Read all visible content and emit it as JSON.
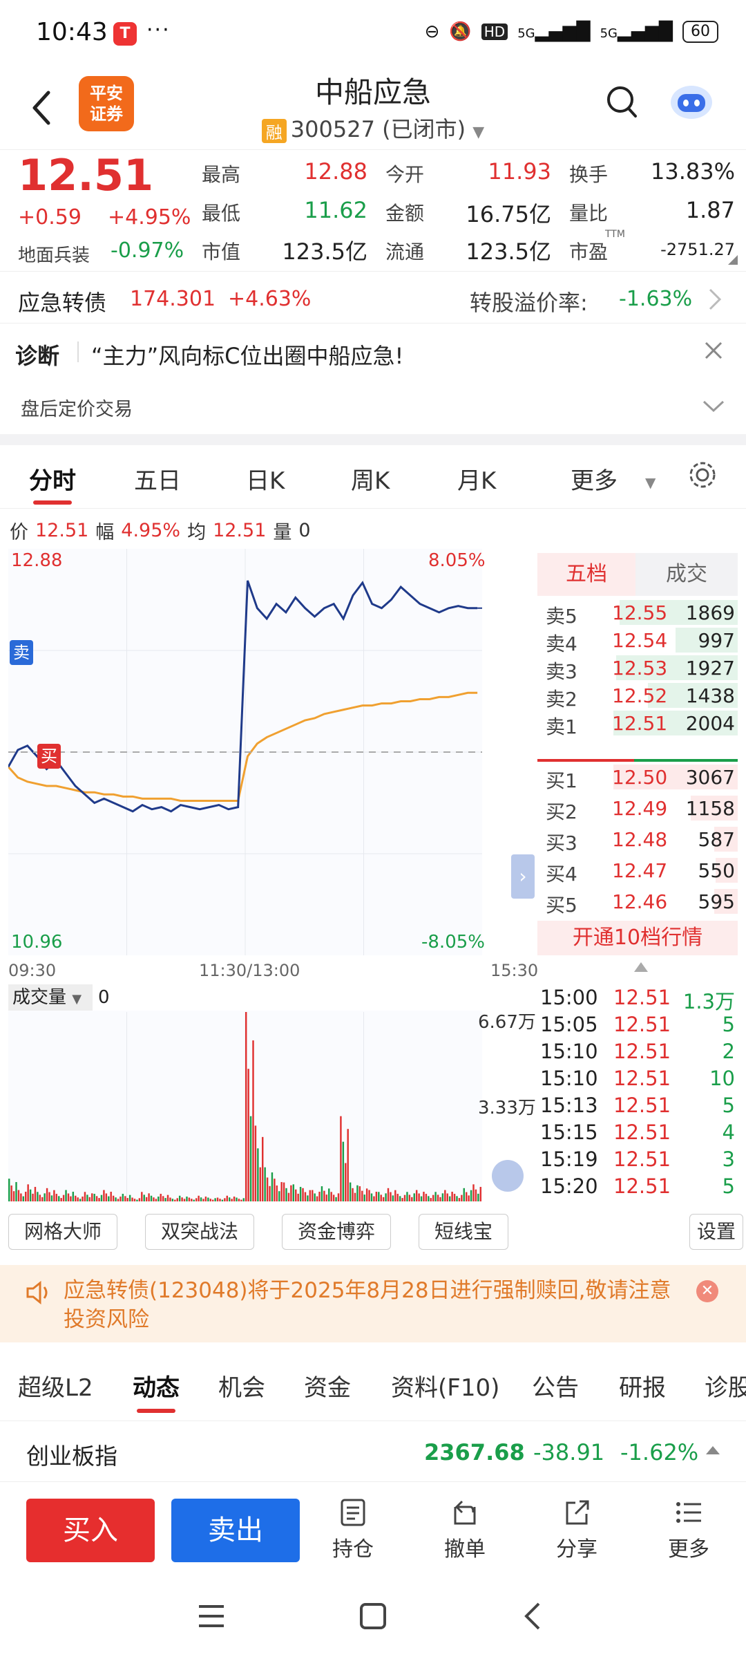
{
  "status_bar": {
    "time": "10:43",
    "dots": "···",
    "battery": "60",
    "network1": "5G",
    "network2": "5G",
    "hd": "HD"
  },
  "header": {
    "title": "中船应急",
    "rong": "融",
    "code_status": "300527 (已闭市)",
    "brand_logo": "平安\n证券"
  },
  "quote": {
    "price": "12.51",
    "change": "+0.59",
    "change_pct": "+4.95%",
    "sector_name": "地面兵装",
    "sector_chg": "-0.97%",
    "stats": [
      {
        "label": "最高",
        "value": "12.88",
        "color": "red"
      },
      {
        "label": "今开",
        "value": "11.93",
        "color": "red"
      },
      {
        "label": "换手",
        "value": "13.83%",
        "color": "black"
      },
      {
        "label": "最低",
        "value": "11.62",
        "color": "green"
      },
      {
        "label": "金额",
        "value": "16.75亿",
        "color": "black"
      },
      {
        "label": "量比",
        "value": "1.87",
        "color": "black"
      },
      {
        "label": "市值",
        "value": "123.5亿",
        "color": "black"
      },
      {
        "label": "流通",
        "value": "123.5亿",
        "color": "black"
      },
      {
        "label": "市盈",
        "value": "-2751.27",
        "color": "black"
      }
    ],
    "pe_sup": "TTM"
  },
  "bond": {
    "name": "应急转债",
    "price": "174.301",
    "chg": "+4.63%",
    "premium_label": "转股溢价率:",
    "premium": "-1.63%"
  },
  "diagnosis": {
    "label": "诊断",
    "text": "“主力”风向标C位出圈中船应急!"
  },
  "after_hours": {
    "label": "盘后定价交易"
  },
  "chart_tabs": [
    "分时",
    "五日",
    "日K",
    "周K",
    "月K",
    "更多"
  ],
  "info_line": {
    "price_label": "价",
    "price": "12.51",
    "amp_label": "幅",
    "amp": "4.95%",
    "avg_label": "均",
    "avg": "12.51",
    "vol_label": "量",
    "vol": "0"
  },
  "chart_data": {
    "type": "line",
    "y_top": "12.88",
    "y_bottom": "10.96",
    "pct_top": "8.05%",
    "pct_bottom": "-8.05%",
    "x_labels": [
      "09:30",
      "11:30/13:00",
      "15:30"
    ],
    "ylim": [
      10.96,
      12.88
    ],
    "prev_close": 11.92,
    "price_series": [
      11.85,
      11.93,
      11.95,
      11.9,
      11.84,
      11.88,
      11.82,
      11.76,
      11.72,
      11.68,
      11.7,
      11.68,
      11.66,
      11.64,
      11.67,
      11.65,
      11.66,
      11.64,
      11.67,
      11.66,
      11.65,
      11.66,
      11.67,
      11.65,
      11.66,
      12.73,
      12.6,
      12.55,
      12.62,
      12.58,
      12.65,
      12.6,
      12.56,
      12.6,
      12.62,
      12.55,
      12.66,
      12.72,
      12.62,
      12.6,
      12.64,
      12.7,
      12.66,
      12.62,
      12.6,
      12.58,
      12.6,
      12.61,
      12.6,
      12.6
    ],
    "avg_series": [
      11.85,
      11.8,
      11.78,
      11.77,
      11.76,
      11.76,
      11.75,
      11.74,
      11.73,
      11.73,
      11.72,
      11.72,
      11.71,
      11.71,
      11.7,
      11.7,
      11.7,
      11.7,
      11.69,
      11.69,
      11.69,
      11.69,
      11.69,
      11.69,
      11.69,
      11.9,
      11.96,
      11.99,
      12.01,
      12.03,
      12.05,
      12.07,
      12.08,
      12.1,
      12.11,
      12.12,
      12.13,
      12.14,
      12.14,
      12.15,
      12.15,
      12.16,
      12.16,
      12.17,
      12.17,
      12.18,
      12.18,
      12.19,
      12.2,
      12.2
    ],
    "markers": {
      "sell": "卖",
      "buy": "买"
    }
  },
  "order_book": {
    "tabs": [
      "五档",
      "成交"
    ],
    "asks": [
      {
        "label": "卖5",
        "price": "12.55",
        "vol": "1869",
        "fill": 0.95
      },
      {
        "label": "卖4",
        "price": "12.54",
        "vol": "997",
        "fill": 0.5
      },
      {
        "label": "卖3",
        "price": "12.53",
        "vol": "1927",
        "fill": 0.98
      },
      {
        "label": "卖2",
        "price": "12.52",
        "vol": "1438",
        "fill": 0.72
      },
      {
        "label": "卖1",
        "price": "12.51",
        "vol": "2004",
        "fill": 1.0
      }
    ],
    "bids": [
      {
        "label": "买1",
        "price": "12.50",
        "vol": "3067",
        "fill": 1.0
      },
      {
        "label": "买2",
        "price": "12.49",
        "vol": "1158",
        "fill": 0.38
      },
      {
        "label": "买3",
        "price": "12.48",
        "vol": "587",
        "fill": 0.19
      },
      {
        "label": "买4",
        "price": "12.47",
        "vol": "550",
        "fill": 0.18
      },
      {
        "label": "买5",
        "price": "12.46",
        "vol": "595",
        "fill": 0.19
      }
    ],
    "upgrade": "开通10档行情"
  },
  "volume_panel": {
    "label": "成交量",
    "value": "0",
    "max_label": "6.67万",
    "mid_label": "3.33万"
  },
  "volume_data": [
    12,
    6,
    9,
    5,
    7,
    4,
    6,
    3,
    5,
    4,
    6,
    3,
    4,
    2,
    5,
    3,
    4,
    2,
    3,
    2,
    3,
    2,
    2,
    3,
    2,
    100,
    40,
    18,
    12,
    10,
    9,
    7,
    6,
    8,
    5,
    45,
    10,
    8,
    6,
    5,
    7,
    4,
    5,
    6,
    4,
    5,
    6,
    4,
    7,
    9
  ],
  "ticks": [
    {
      "time": "15:00",
      "price": "12.51",
      "vol": "1.3万"
    },
    {
      "time": "15:05",
      "price": "12.51",
      "vol": "5"
    },
    {
      "time": "15:10",
      "price": "12.51",
      "vol": "2"
    },
    {
      "time": "15:10",
      "price": "12.51",
      "vol": "10"
    },
    {
      "time": "15:13",
      "price": "12.51",
      "vol": "5"
    },
    {
      "time": "15:15",
      "price": "12.51",
      "vol": "4"
    },
    {
      "time": "15:19",
      "price": "12.51",
      "vol": "3"
    },
    {
      "time": "15:20",
      "price": "12.51",
      "vol": "5"
    }
  ],
  "tools": [
    "网格大师",
    "双突战法",
    "资金博弈",
    "短线宝",
    "设置"
  ],
  "notice": {
    "text": "应急转债(123048)将于2025年8月28日进行强制赎回,敬请注意投资风险"
  },
  "info_tabs": [
    "超级L2",
    "动态",
    "机会",
    "资金",
    "资料(F10)",
    "公告",
    "研报",
    "诊股"
  ],
  "index_row": {
    "name": "创业板指",
    "value": "2367.68",
    "chg": "-38.91",
    "pct": "-1.62%"
  },
  "actions": {
    "buy": "买入",
    "sell": "卖出",
    "hold": "持仓",
    "cancel": "撤单",
    "share": "分享",
    "more": "更多"
  },
  "colors": {
    "red": "#e03030",
    "green": "#1a9e4a",
    "blue_line": "#1f3a8a",
    "avg_line": "#f0a030",
    "buy_btn": "#e62e2e",
    "sell_btn": "#1e6ee8"
  }
}
